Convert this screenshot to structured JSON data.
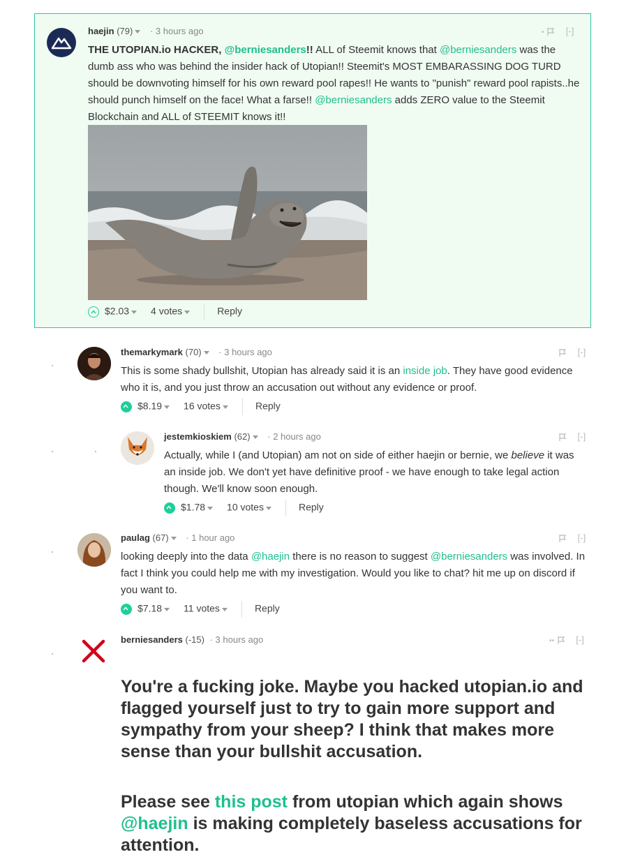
{
  "colors": {
    "accent": "#1fbf8f",
    "highlight_bg": "#f0fbf2",
    "highlight_border": "#2fc4a2",
    "flag_red": "#d0021b"
  },
  "comments": [
    {
      "author": "haejin",
      "reputation": "(79)",
      "time": "3 hours ago",
      "body_bold_start": "THE UTOPIAN.io HACKER, ",
      "body_mention_1": "@berniesanders",
      "body_bold_end": "!!",
      "body_1": " ALL of Steemit knows that ",
      "body_mention_2": "@berniesanders",
      "body_2": " was the dumb ass who was behind the insider hack of Utopian!! Steemit's MOST EMBARASSING DOG TURD should be downvoting himself for his own reward pool rapes!! He wants to \"punish\" reward pool rapists..he should punch himself on the face! What a farse!! ",
      "body_mention_3": "@berniesanders",
      "body_3": " adds ZERO value to the Steemit Blockchain and ALL of STEEMIT knows it!!",
      "image_icon": "seal-photo",
      "payout": "$2.03",
      "votes": "4 votes",
      "reply": "Reply",
      "collapse": "[-]"
    },
    {
      "author": "themarkymark",
      "reputation": "(70)",
      "time": "3 hours ago",
      "body_1": "This is some shady bullshit, Utopian has already said it is an ",
      "body_link": "inside job",
      "body_2": ". They have good evidence who it is, and you just throw an accusation out without any evidence or proof.",
      "payout": "$8.19",
      "votes": "16 votes",
      "reply": "Reply",
      "collapse": "[-]"
    },
    {
      "author": "jestemkioskiem",
      "reputation": "(62)",
      "time": "2 hours ago",
      "body_1": "Actually, while I (and Utopian) am not on side of either haejin or bernie, we ",
      "body_italic": "believe",
      "body_2": " it was an inside job. We don't yet have definitive proof - we have enough to take legal action though. We'll know soon enough.",
      "payout": "$1.78",
      "votes": "10 votes",
      "reply": "Reply",
      "collapse": "[-]"
    },
    {
      "author": "paulag",
      "reputation": "(67)",
      "time": "1 hour ago",
      "body_1": "looking deeply into the data ",
      "body_mention_1": "@haejin",
      "body_2": " there is no reason to suggest ",
      "body_mention_2": "@berniesanders",
      "body_3": " was involved. In fact I think you could help me with my investigation. Would you like to chat? hit me up on discord if you want to.",
      "payout": "$7.18",
      "votes": "11 votes",
      "reply": "Reply",
      "collapse": "[-]"
    },
    {
      "author": "berniesanders",
      "reputation": "(-15)",
      "time": "3 hours ago",
      "para_1": "You're a fucking joke. Maybe you hacked utopian.io and flagged yourself just to try to gain more support and sympathy from your sheep? I think that makes more sense than your bullshit accusation.",
      "para_2_a": "Please see ",
      "para_2_link": "this post",
      "para_2_b": " from utopian which again shows ",
      "para_2_mention": "@haejin",
      "para_2_c": " is making completely baseless accusations for attention.",
      "collapse": "[-]"
    }
  ]
}
